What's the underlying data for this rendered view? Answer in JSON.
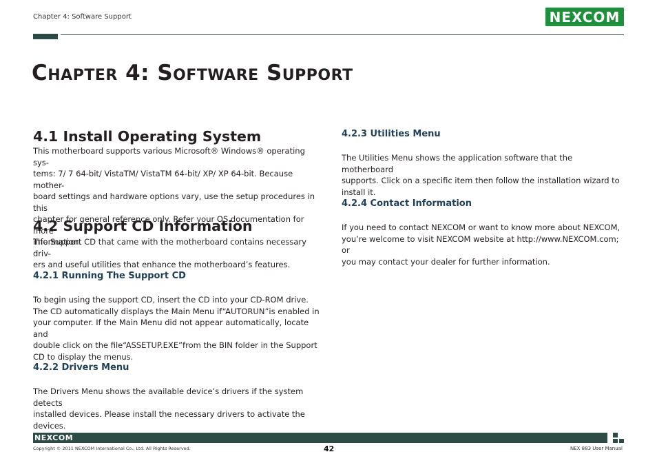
{
  "header": {
    "chapter_label": "Chapter 4: Software Support",
    "logo_text": "NEXCOM"
  },
  "chapter_title": "Chapter 4: Software Support",
  "left": {
    "s41_title": "4.1 Install Operating System",
    "s41_lines": [
      "This motherboard supports various Microsoft® Windows® operating sys-",
      "tems: 7/ 7 64-bit/ VistaTM/ VistaTM 64-bit/ XP/ XP 64-bit. Because mother-",
      "board settings and hardware options vary, use the setup procedures in this",
      "chapter for general reference only. Refer your OS documentation for more",
      "information."
    ],
    "s42_title": "4.2 Support CD Information",
    "s42_lines": [
      "The Support CD that came with the motherboard contains necessary driv-",
      "ers and useful utilities that enhance the motherboard’s features."
    ],
    "s421_title": "4.2.1 Running The Support CD",
    "s421_lines": [
      "To begin using the support CD, insert the CD into your CD-ROM drive.",
      "The CD automatically displays the Main Menu if“AUTORUN”is enabled in",
      "your computer. If the Main Menu did not appear automatically, locate and",
      "double click on the file“ASSETUP.EXE”from the BIN folder in the Support",
      "CD to display the menus."
    ],
    "s422_title": "4.2.2 Drivers Menu",
    "s422_lines": [
      "The Drivers Menu shows the available device’s drivers if the system detects",
      "installed devices. Please install the necessary drivers to activate the devices."
    ]
  },
  "right": {
    "s423_title": "4.2.3 Utilities Menu",
    "s423_lines": [
      "The Utilities Menu shows the application software that the motherboard",
      "supports. Click on a specific item then follow the installation wizard to",
      "install it."
    ],
    "s424_title": "4.2.4 Contact Information",
    "s424_lines": [
      "If you need to contact NEXCOM or want to know more about NEXCOM,",
      "you’re welcome to visit NEXCOM website at http://www.NEXCOM.com; or",
      "you may contact your dealer for further information."
    ]
  },
  "footer": {
    "logo_text": "NEXCOM",
    "copyright": "Copyright © 2011 NEXCOM International Co., Ltd. All Rights Reserved.",
    "page_number": "42",
    "manual_name": "NEX 883 User Manual"
  },
  "colors": {
    "brand_green": "#1e8f3a",
    "bar_dark": "#2d4b47",
    "heading_blue": "#1f3f56"
  }
}
